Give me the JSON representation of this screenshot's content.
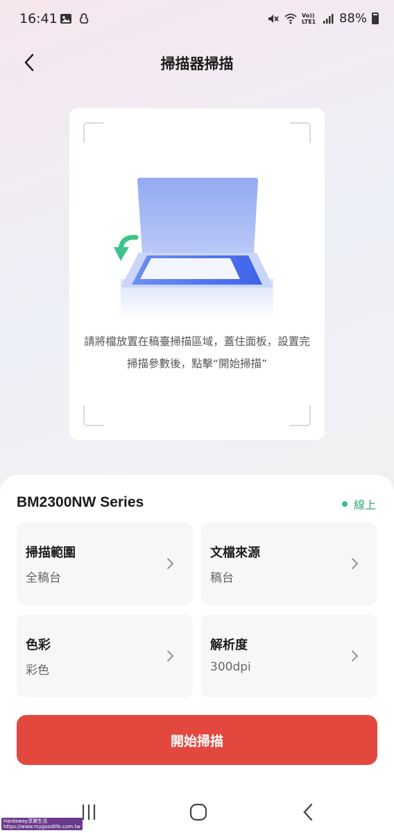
{
  "status_bar": {
    "time": "16:41",
    "battery": "88%",
    "left_icons": [
      "image-icon",
      "notification-app-icon"
    ],
    "right_icons": [
      "mute-icon",
      "wifi-icon",
      "volte-icon",
      "signal-icon",
      "battery-icon"
    ],
    "volte_text": "Vo)) LTE1"
  },
  "header": {
    "title": "掃描器掃描",
    "back_icon": "chevron-left-icon"
  },
  "illustration": {
    "icon": "scanner-illustration",
    "instruction": "請將檔放置在稿臺掃描區域，蓋住面板，設置完掃描參數後，點擊“開始掃描”"
  },
  "printer": {
    "name": "BM2300NW Series",
    "status": "線上",
    "status_color": "#3dbb84"
  },
  "options": [
    {
      "label": "掃描範圍",
      "value": "全稿台"
    },
    {
      "label": "文檔來源",
      "value": "稿台"
    },
    {
      "label": "色彩",
      "value": "彩色"
    },
    {
      "label": "解析度",
      "value": "300dpi"
    }
  ],
  "start_button": {
    "label": "開始掃描",
    "color": "#e2483e"
  },
  "nav": {
    "recent_icon": "recent-apps-icon",
    "home_icon": "home-icon",
    "back_icon": "back-icon"
  },
  "watermark": {
    "line1": "Hardaway享樂生活",
    "line2": "https://www.mygoodlife.com.tw"
  }
}
